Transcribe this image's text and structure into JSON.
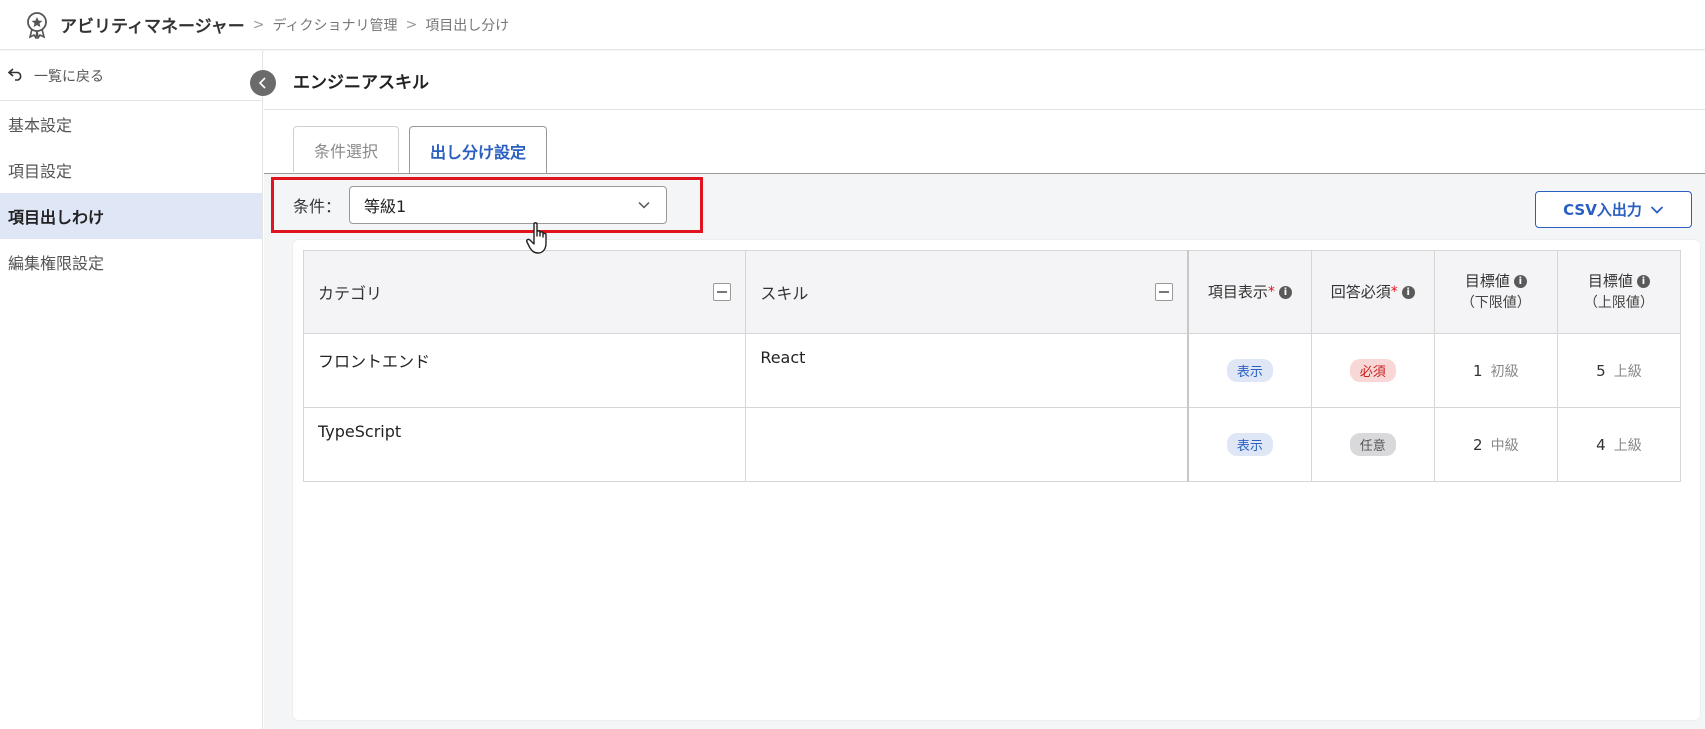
{
  "header": {
    "app_title": "アビリティマネージャー",
    "breadcrumbs": [
      "ディクショナリ管理",
      "項目出し分け"
    ],
    "separator": ">"
  },
  "sidebar": {
    "back_label": "一覧に戻る",
    "items": [
      {
        "label": "基本設定",
        "active": false
      },
      {
        "label": "項目設定",
        "active": false
      },
      {
        "label": "項目出しわけ",
        "active": true
      },
      {
        "label": "編集権限設定",
        "active": false
      }
    ]
  },
  "main": {
    "title": "エンジニアスキル",
    "tabs": [
      {
        "label": "条件選択",
        "active": false
      },
      {
        "label": "出し分け設定",
        "active": true
      }
    ],
    "condition": {
      "label": "条件：",
      "value": "等級1"
    },
    "csv_button": "CSV入出力"
  },
  "table": {
    "headers": {
      "category": "カテゴリ",
      "skill": "スキル",
      "display": "項目表示",
      "required": "回答必須",
      "target_low": "目標値",
      "target_low_sub": "（下限値）",
      "target_high": "目標値",
      "target_high_sub": "（上限値）",
      "required_mark": "*",
      "info_glyph": "i"
    },
    "rows": [
      {
        "category": "フロントエンド",
        "skill": "React",
        "display": "表示",
        "required": "必須",
        "low_num": "1",
        "low_name": "初級",
        "high_num": "5",
        "high_name": "上級"
      },
      {
        "category": "TypeScript",
        "skill": "",
        "display": "表示",
        "required": "任意",
        "low_num": "2",
        "low_name": "中級",
        "high_num": "4",
        "high_name": "上級"
      }
    ]
  },
  "colors": {
    "accent": "#2a5fc1",
    "highlight_border": "#e0141e",
    "sidebar_active_bg": "#dfe7f7"
  }
}
